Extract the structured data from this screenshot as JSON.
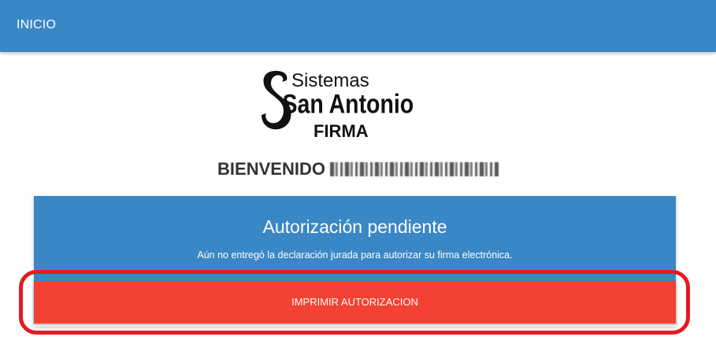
{
  "topbar": {
    "home_label": "INICIO",
    "color": "#3a87c6"
  },
  "logo": {
    "line1": "Sistemas",
    "line2": "San Antonio",
    "line3": "FIRMA"
  },
  "welcome": {
    "label": "BIENVENIDO",
    "user_name_redacted": true
  },
  "card": {
    "title": "Autorización pendiente",
    "message": "Aún no entregó la declaración jurada para autorizar su firma electrónica.",
    "button_label": "IMPRIMIR AUTORIZACION",
    "header_color": "#3a87c6",
    "button_color": "#f34133"
  },
  "annotation": {
    "highlight_color": "#e31b23"
  }
}
